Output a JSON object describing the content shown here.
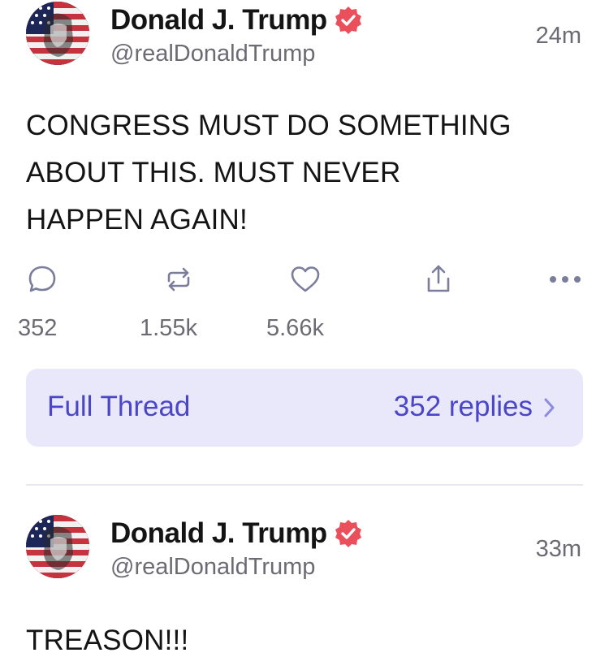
{
  "posts": [
    {
      "display_name": "Donald J. Trump",
      "handle": "@realDonaldTrump",
      "time": "24m",
      "text_lines": [
        "CONGRESS MUST DO SOMETHING",
        "ABOUT THIS. MUST NEVER",
        "HAPPEN AGAIN!"
      ],
      "counts": {
        "replies": "352",
        "reposts": "1.55k",
        "likes": "5.66k"
      },
      "thread": {
        "label": "Full Thread",
        "replies": "352 replies"
      }
    },
    {
      "display_name": "Donald J. Trump",
      "handle": "@realDonaldTrump",
      "time": "33m",
      "text_lines": [
        "TREASON!!!"
      ]
    }
  ],
  "icons": {
    "reply": "speech-bubble-icon",
    "repost": "repost-arrows-icon",
    "like": "heart-icon",
    "share": "share-upload-icon",
    "more": "more-dots-icon",
    "verified": "verified-badge-icon",
    "chevron": "chevron-right-icon"
  },
  "colors": {
    "accent": "#4b45c8",
    "thread_bg": "#e9e8fb",
    "verified": "#ea4f5b",
    "muted_text": "#6b6b73",
    "icon": "#7b7d9c"
  }
}
